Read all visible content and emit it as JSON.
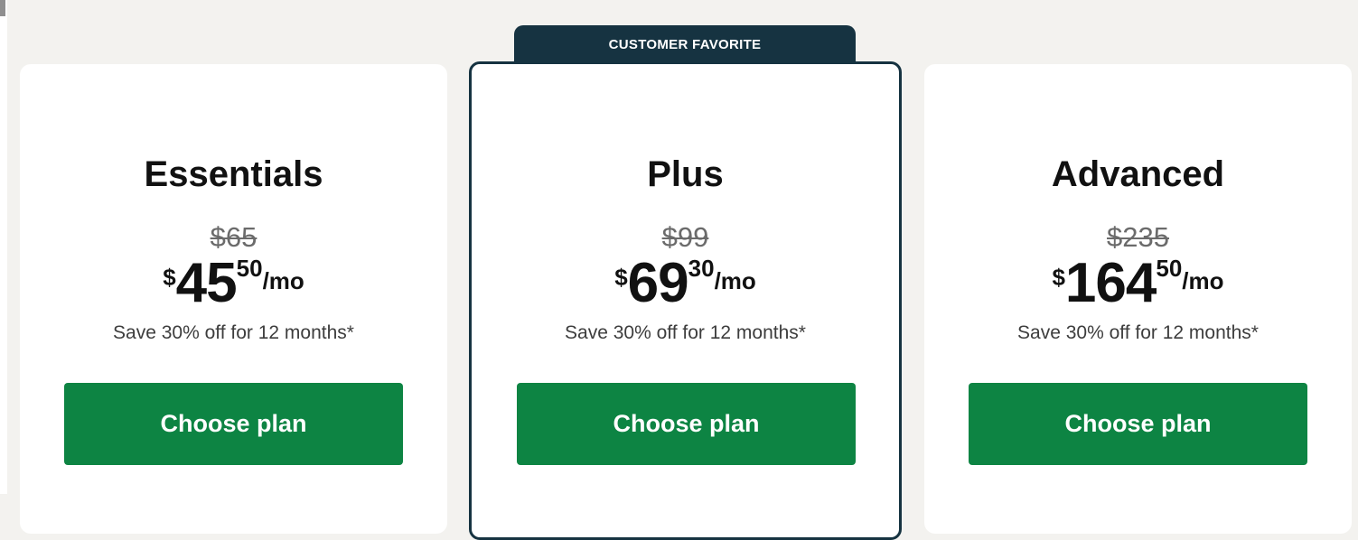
{
  "badge": {
    "label": "CUSTOMER FAVORITE"
  },
  "plans": [
    {
      "name": "Essentials",
      "old_price": "$65",
      "currency": "$",
      "price_whole": "45",
      "price_cents": "50",
      "per": "/mo",
      "save_note": "Save 30% off for 12 months*",
      "button_label": "Choose plan"
    },
    {
      "name": "Plus",
      "old_price": "$99",
      "currency": "$",
      "price_whole": "69",
      "price_cents": "30",
      "per": "/mo",
      "save_note": "Save 30% off for 12 months*",
      "button_label": "Choose plan"
    },
    {
      "name": "Advanced",
      "old_price": "$235",
      "currency": "$",
      "price_whole": "164",
      "price_cents": "50",
      "per": "/mo",
      "save_note": "Save 30% off for 12 months*",
      "button_label": "Choose plan"
    }
  ],
  "colors": {
    "page_background": "#f3f2ef",
    "card_background": "#ffffff",
    "badge_background": "#163341",
    "featured_border": "#163341",
    "button_background": "#0d8443",
    "button_text": "#ffffff",
    "old_price_text": "#6b6b6b"
  }
}
